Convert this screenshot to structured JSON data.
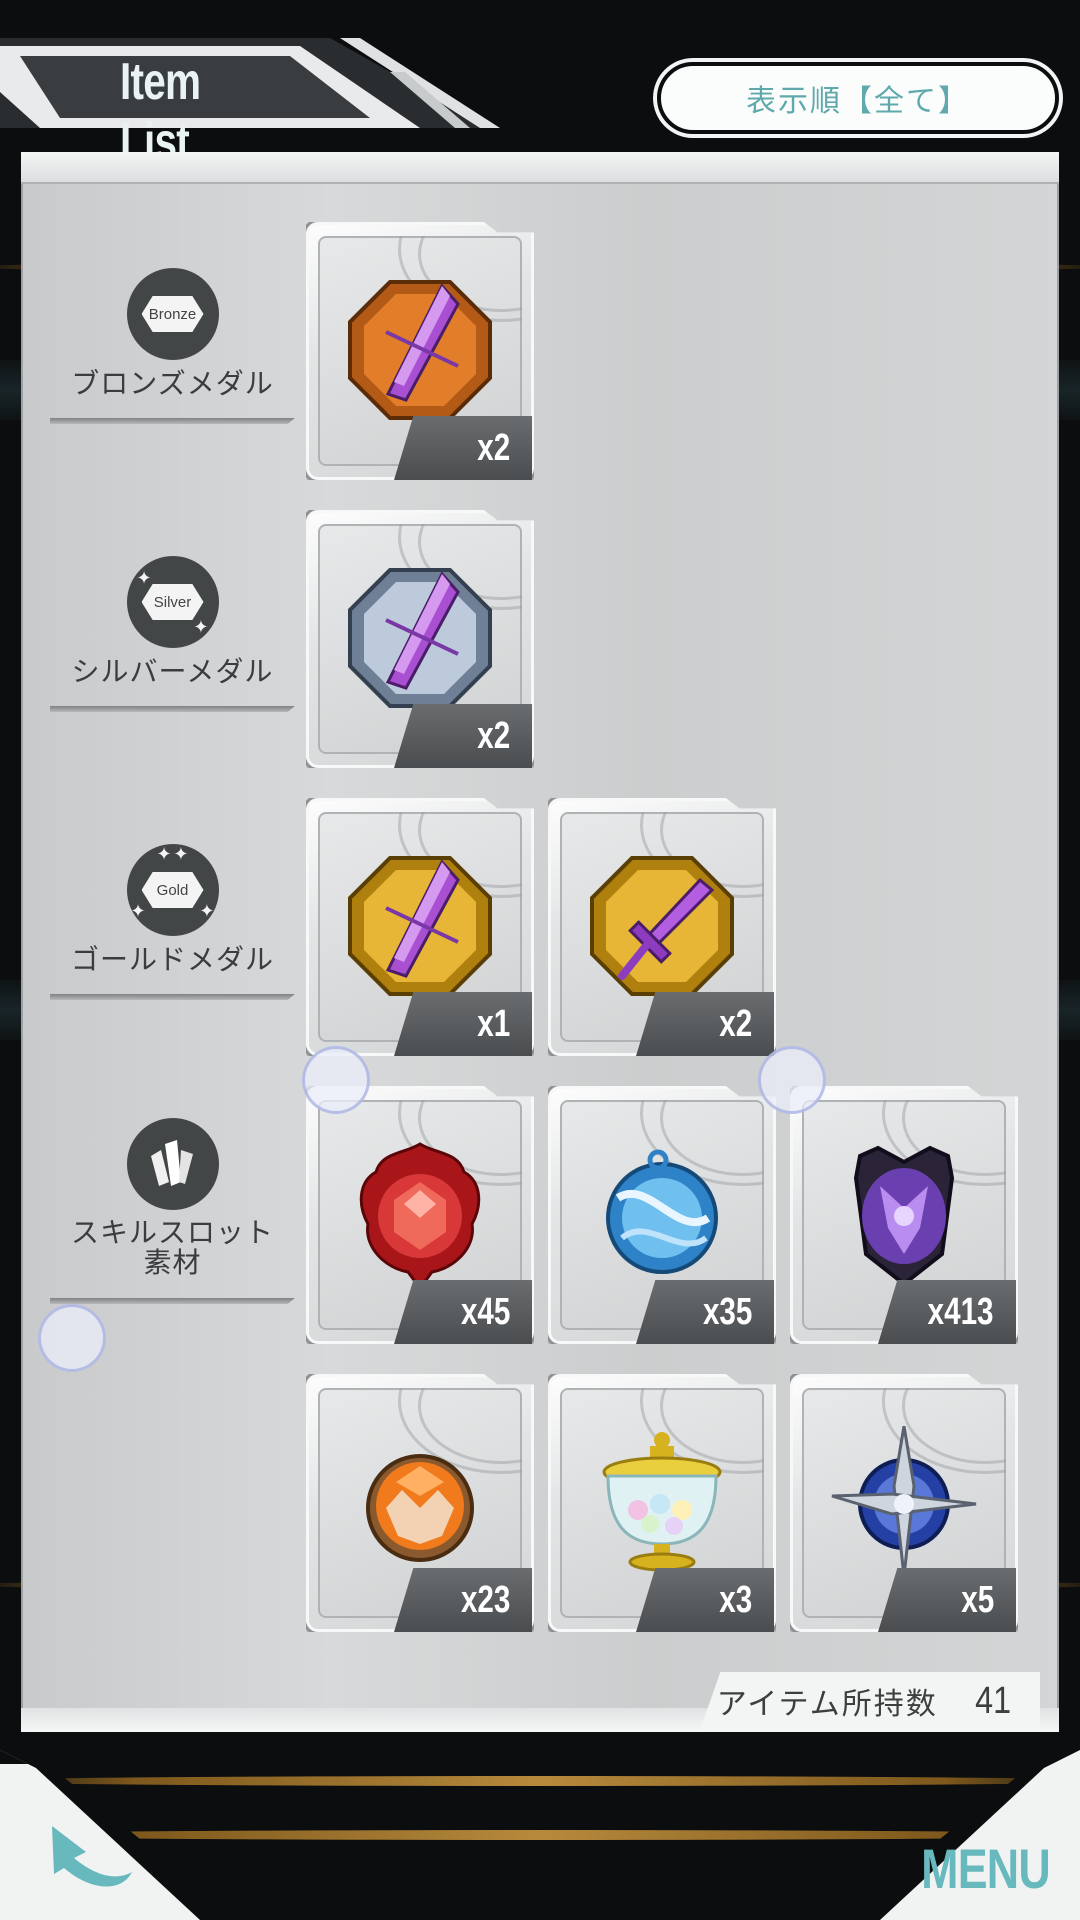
{
  "header": {
    "title": "Item List",
    "sort_button_label": "表示順【全て】"
  },
  "categories": [
    {
      "id": "bronze",
      "label": "ブロンズメダル",
      "badge": "Bronze"
    },
    {
      "id": "silver",
      "label": "シルバーメダル",
      "badge": "Silver"
    },
    {
      "id": "gold",
      "label": "ゴールドメダル",
      "badge": "Gold"
    },
    {
      "id": "skill",
      "label": "スキルスロット\n素材",
      "badge": ""
    }
  ],
  "items": [
    {
      "category": "bronze",
      "icon": "bronze-drill-medal-icon",
      "qty": "x2"
    },
    {
      "category": "silver",
      "icon": "silver-drill-medal-icon",
      "qty": "x2"
    },
    {
      "category": "gold",
      "icon": "gold-drill-medal-icon",
      "qty": "x1"
    },
    {
      "category": "gold",
      "icon": "gold-sword-medal-icon",
      "qty": "x2"
    },
    {
      "category": "skill",
      "icon": "red-flame-orb-icon",
      "qty": "x45"
    },
    {
      "category": "skill",
      "icon": "blue-ice-orb-icon",
      "qty": "x35"
    },
    {
      "category": "skill",
      "icon": "purple-crest-orb-icon",
      "qty": "x413"
    },
    {
      "category": "skill",
      "icon": "orange-crystal-orb-icon",
      "qty": "x23"
    },
    {
      "category": "skill",
      "icon": "glass-jar-icon",
      "qty": "x3"
    },
    {
      "category": "skill",
      "icon": "blue-cross-orb-icon",
      "qty": "x5"
    }
  ],
  "footer": {
    "count_label": "アイテム所持数",
    "count_value": "41",
    "menu_label": "MENU"
  },
  "colors": {
    "accent": "#5fa9ad",
    "panel": "#cfd1d2",
    "qty_tab": "#55585a"
  }
}
